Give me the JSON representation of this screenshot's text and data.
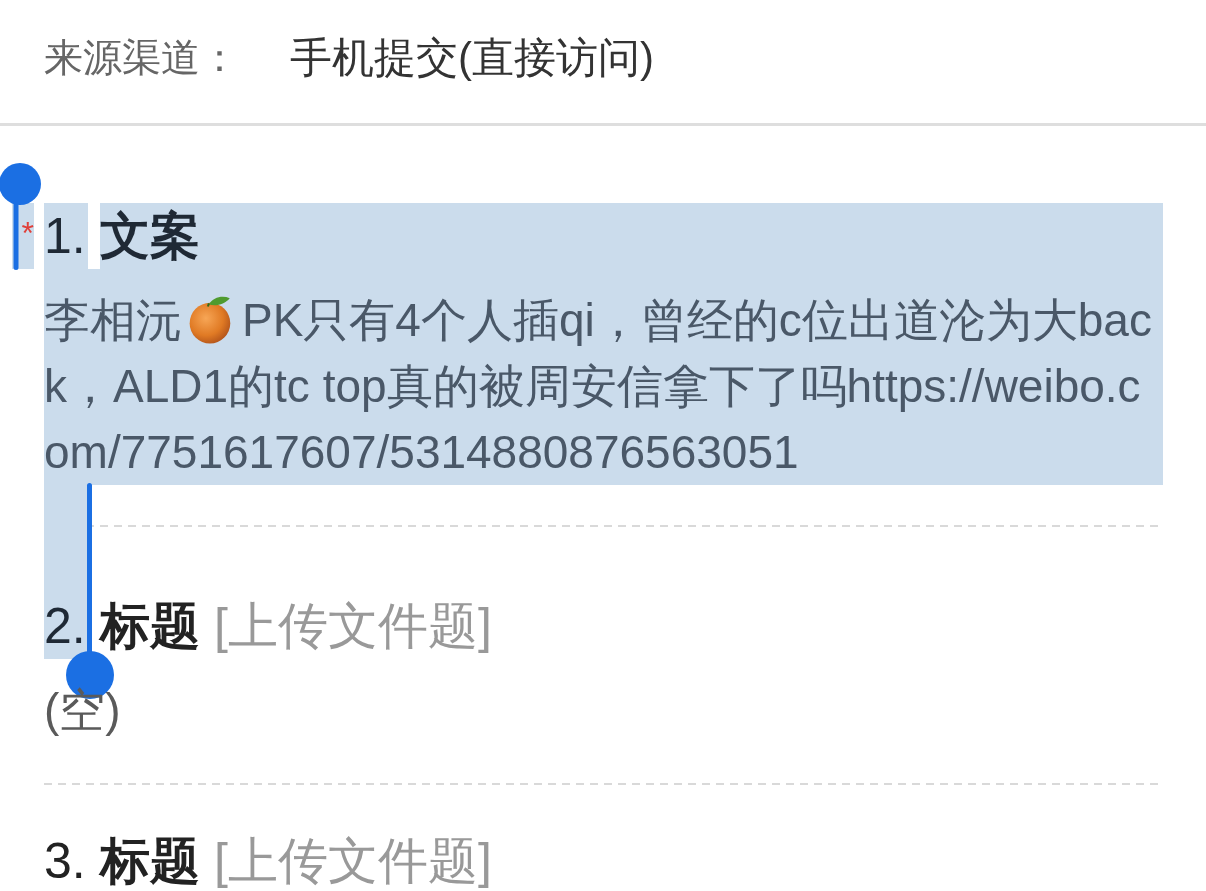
{
  "fields": [
    {
      "label": "来源渠道：",
      "value": "手机提交(直接访问)"
    }
  ],
  "questions": [
    {
      "required_mark": "*",
      "number": "1.",
      "title": "文案",
      "number_selected": true,
      "selected": true,
      "answer": [
        {
          "kind": "text",
          "text": "李相沅"
        },
        {
          "kind": "emoji"
        },
        {
          "kind": "text",
          "text": "PK只有4个人插qi，曾经的c位出道沦为大back，ALD1的tc top真的被周安信拿下了吗https://weibo.com/7751617607/5314880876563051"
        }
      ]
    },
    {
      "number": "2.",
      "title": "标题",
      "type_tag": "[上传文件题]",
      "number_selected": true,
      "selected": false,
      "answer": [
        {
          "kind": "text",
          "text": "(空)"
        }
      ]
    },
    {
      "number": "3.",
      "title": "标题",
      "type_tag": "[上传文件题]",
      "number_selected": false,
      "selected": false
    }
  ]
}
